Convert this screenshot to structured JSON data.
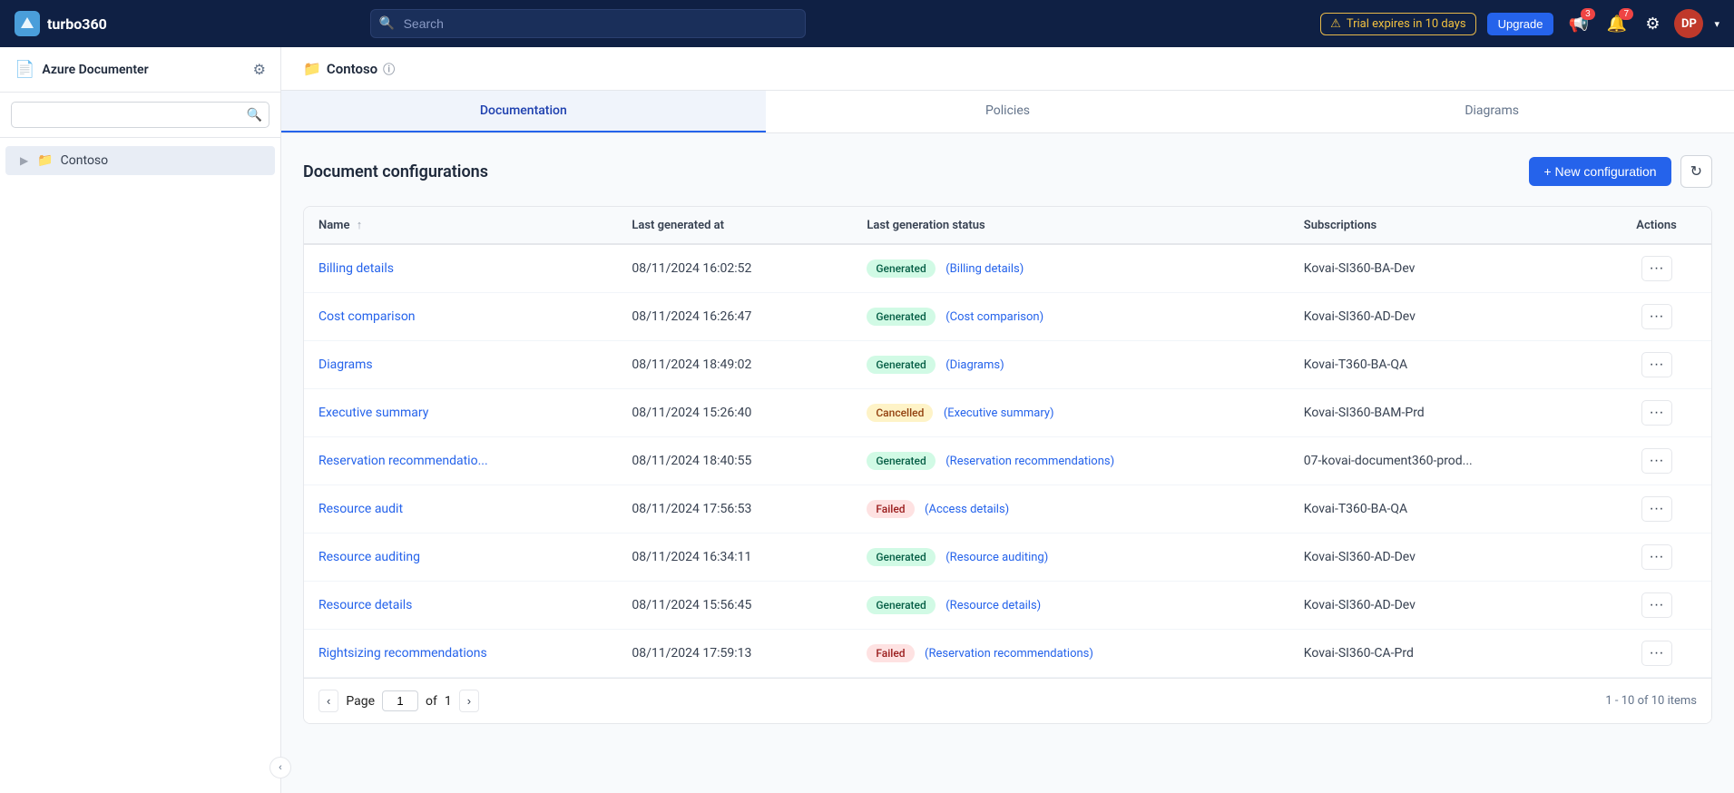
{
  "app": {
    "name": "turbo360",
    "logo_text": "T",
    "logo_bg": "#4a9eda"
  },
  "topnav": {
    "search_placeholder": "Search",
    "trial_text": "Trial expires in 10 days",
    "upgrade_label": "Upgrade",
    "notifications_count": "3",
    "alerts_count": "7",
    "avatar_initials": "DP",
    "avatar_chevron": "▾"
  },
  "sidebar": {
    "title": "Azure Documenter",
    "search_placeholder": "",
    "items": [
      {
        "label": "Contoso",
        "icon": "folder",
        "active": true
      }
    ]
  },
  "breadcrumb": {
    "folder_icon": "📁",
    "title": "Contoso",
    "info_icon": "ⓘ"
  },
  "tabs": [
    {
      "label": "Documentation",
      "active": true
    },
    {
      "label": "Policies",
      "active": false
    },
    {
      "label": "Diagrams",
      "active": false
    }
  ],
  "content": {
    "title": "Document configurations",
    "new_config_label": "+ New configuration",
    "refresh_icon": "↻"
  },
  "table": {
    "columns": [
      {
        "label": "Name",
        "sortable": true,
        "sort_icon": "↑"
      },
      {
        "label": "Last generated at",
        "sortable": false
      },
      {
        "label": "Last generation status",
        "sortable": false
      },
      {
        "label": "Subscriptions",
        "sortable": false
      },
      {
        "label": "Actions",
        "sortable": false
      }
    ],
    "rows": [
      {
        "name": "Billing details",
        "last_generated": "08/11/2024 16:02:52",
        "status": "Generated",
        "status_type": "generated",
        "detail_label": "(Billing details)",
        "subscriptions": "Kovai-SI360-BA-Dev"
      },
      {
        "name": "Cost comparison",
        "last_generated": "08/11/2024 16:26:47",
        "status": "Generated",
        "status_type": "generated",
        "detail_label": "(Cost comparison)",
        "subscriptions": "Kovai-SI360-AD-Dev"
      },
      {
        "name": "Diagrams",
        "last_generated": "08/11/2024 18:49:02",
        "status": "Generated",
        "status_type": "generated",
        "detail_label": "(Diagrams)",
        "subscriptions": "Kovai-T360-BA-QA"
      },
      {
        "name": "Executive summary",
        "last_generated": "08/11/2024 15:26:40",
        "status": "Cancelled",
        "status_type": "cancelled",
        "detail_label": "(Executive summary)",
        "subscriptions": "Kovai-SI360-BAM-Prd"
      },
      {
        "name": "Reservation recommendatio...",
        "last_generated": "08/11/2024 18:40:55",
        "status": "Generated",
        "status_type": "generated",
        "detail_label": "(Reservation recommendations)",
        "subscriptions": "07-kovai-document360-prod..."
      },
      {
        "name": "Resource audit",
        "last_generated": "08/11/2024 17:56:53",
        "status": "Failed",
        "status_type": "failed",
        "detail_label": "(Access details)",
        "subscriptions": "Kovai-T360-BA-QA"
      },
      {
        "name": "Resource auditing",
        "last_generated": "08/11/2024 16:34:11",
        "status": "Generated",
        "status_type": "generated",
        "detail_label": "(Resource auditing)",
        "subscriptions": "Kovai-SI360-AD-Dev"
      },
      {
        "name": "Resource details",
        "last_generated": "08/11/2024 15:56:45",
        "status": "Generated",
        "status_type": "generated",
        "detail_label": "(Resource details)",
        "subscriptions": "Kovai-SI360-AD-Dev"
      },
      {
        "name": "Rightsizing recommendations",
        "last_generated": "08/11/2024 17:59:13",
        "status": "Failed",
        "status_type": "failed",
        "detail_label": "(Reservation recommendations)",
        "subscriptions": "Kovai-SI360-CA-Prd"
      }
    ]
  },
  "pagination": {
    "page_label": "Page",
    "current_page": "1",
    "of_label": "of",
    "total_pages": "1",
    "summary": "1 - 10 of 10 items"
  }
}
